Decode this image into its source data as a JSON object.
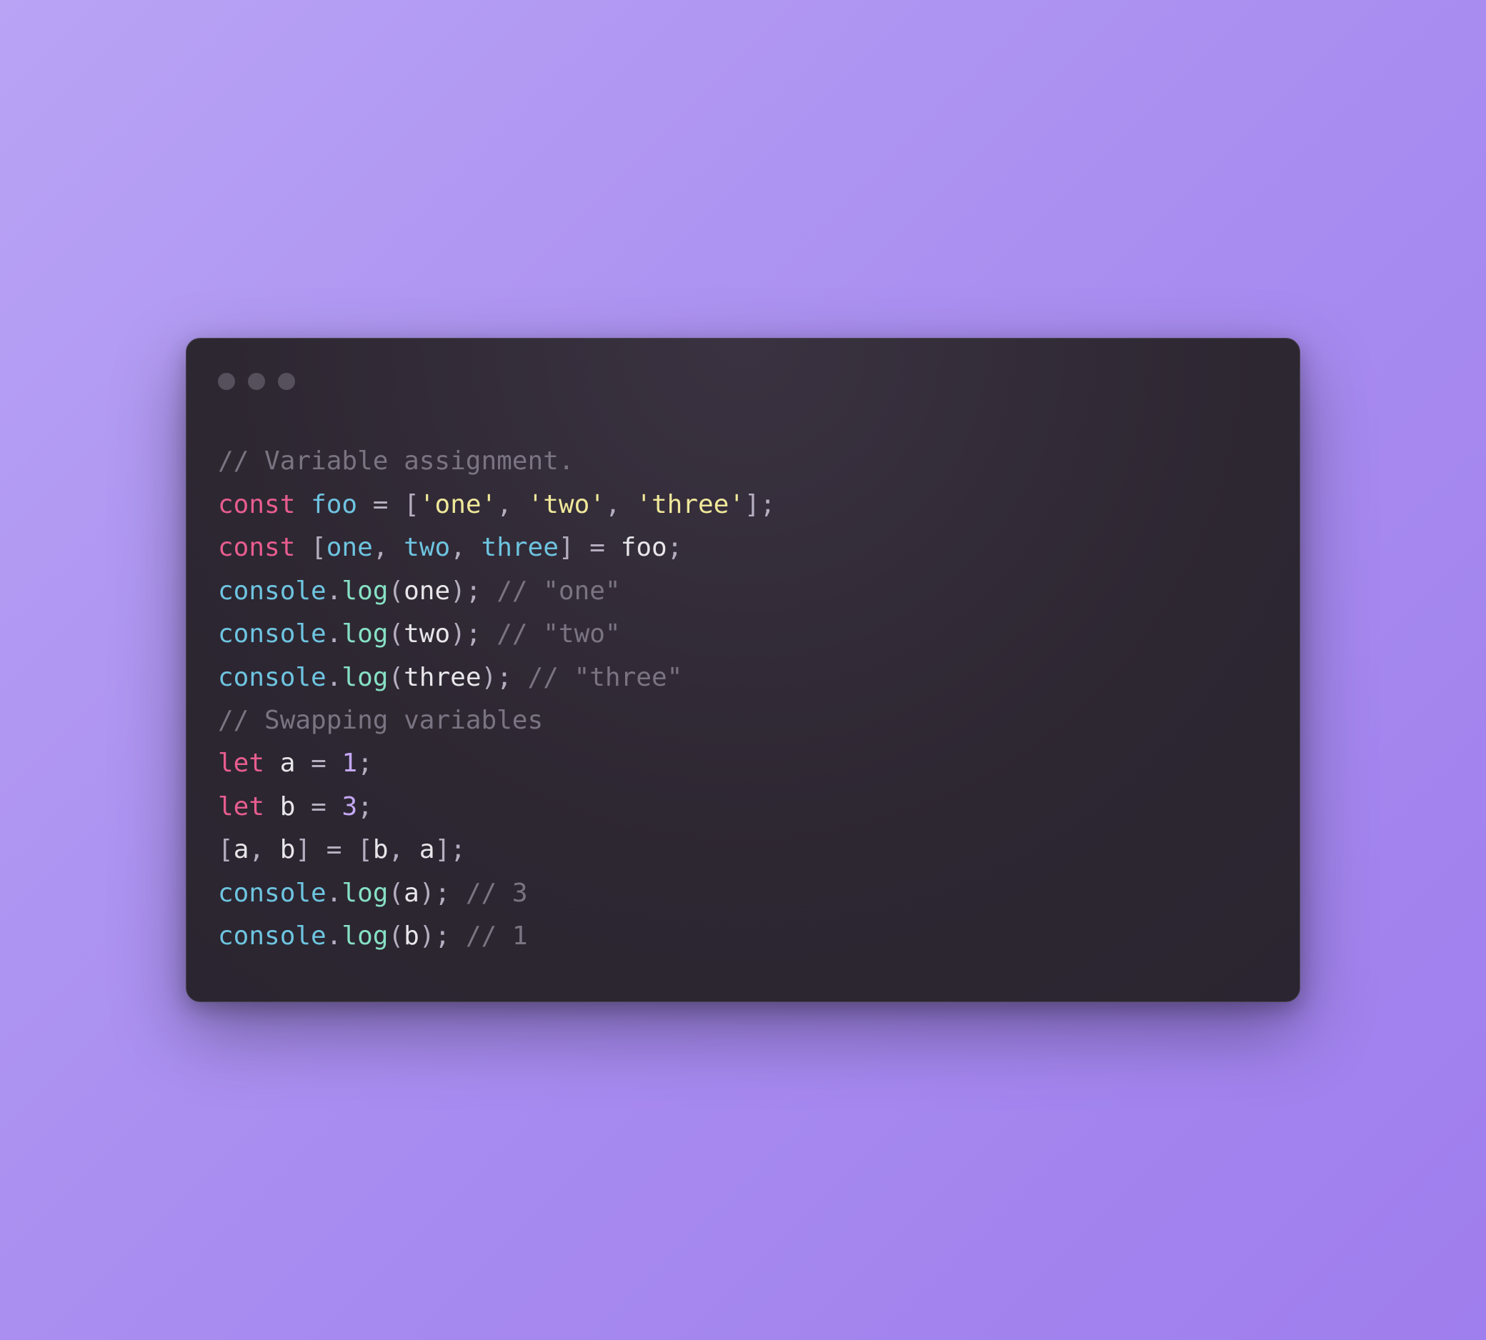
{
  "code": {
    "lines": [
      [
        {
          "cls": "tok-comment",
          "text": "// Variable assignment."
        }
      ],
      [
        {
          "cls": "tok-keyword",
          "text": "const"
        },
        {
          "cls": "tok-plain",
          "text": " "
        },
        {
          "cls": "tok-var",
          "text": "foo"
        },
        {
          "cls": "tok-plain",
          "text": " "
        },
        {
          "cls": "tok-punct",
          "text": "="
        },
        {
          "cls": "tok-plain",
          "text": " "
        },
        {
          "cls": "tok-punct",
          "text": "["
        },
        {
          "cls": "tok-string",
          "text": "'one'"
        },
        {
          "cls": "tok-punct",
          "text": ", "
        },
        {
          "cls": "tok-string",
          "text": "'two'"
        },
        {
          "cls": "tok-punct",
          "text": ", "
        },
        {
          "cls": "tok-string",
          "text": "'three'"
        },
        {
          "cls": "tok-punct",
          "text": "];"
        }
      ],
      [
        {
          "cls": "tok-keyword",
          "text": "const"
        },
        {
          "cls": "tok-plain",
          "text": " "
        },
        {
          "cls": "tok-punct",
          "text": "["
        },
        {
          "cls": "tok-var",
          "text": "one"
        },
        {
          "cls": "tok-punct",
          "text": ", "
        },
        {
          "cls": "tok-var",
          "text": "two"
        },
        {
          "cls": "tok-punct",
          "text": ", "
        },
        {
          "cls": "tok-var",
          "text": "three"
        },
        {
          "cls": "tok-punct",
          "text": "]"
        },
        {
          "cls": "tok-plain",
          "text": " "
        },
        {
          "cls": "tok-punct",
          "text": "="
        },
        {
          "cls": "tok-plain",
          "text": " foo"
        },
        {
          "cls": "tok-punct",
          "text": ";"
        }
      ],
      [
        {
          "cls": "tok-var",
          "text": "console"
        },
        {
          "cls": "tok-punct",
          "text": "."
        },
        {
          "cls": "tok-func",
          "text": "log"
        },
        {
          "cls": "tok-punct",
          "text": "("
        },
        {
          "cls": "tok-plain",
          "text": "one"
        },
        {
          "cls": "tok-punct",
          "text": ");"
        },
        {
          "cls": "tok-plain",
          "text": " "
        },
        {
          "cls": "tok-comment",
          "text": "// \"one\""
        }
      ],
      [
        {
          "cls": "tok-var",
          "text": "console"
        },
        {
          "cls": "tok-punct",
          "text": "."
        },
        {
          "cls": "tok-func",
          "text": "log"
        },
        {
          "cls": "tok-punct",
          "text": "("
        },
        {
          "cls": "tok-plain",
          "text": "two"
        },
        {
          "cls": "tok-punct",
          "text": ");"
        },
        {
          "cls": "tok-plain",
          "text": " "
        },
        {
          "cls": "tok-comment",
          "text": "// \"two\""
        }
      ],
      [
        {
          "cls": "tok-var",
          "text": "console"
        },
        {
          "cls": "tok-punct",
          "text": "."
        },
        {
          "cls": "tok-func",
          "text": "log"
        },
        {
          "cls": "tok-punct",
          "text": "("
        },
        {
          "cls": "tok-plain",
          "text": "three"
        },
        {
          "cls": "tok-punct",
          "text": ");"
        },
        {
          "cls": "tok-plain",
          "text": " "
        },
        {
          "cls": "tok-comment",
          "text": "// \"three\""
        }
      ],
      [
        {
          "cls": "tok-comment",
          "text": "// Swapping variables"
        }
      ],
      [
        {
          "cls": "tok-keyword",
          "text": "let"
        },
        {
          "cls": "tok-plain",
          "text": " a "
        },
        {
          "cls": "tok-punct",
          "text": "="
        },
        {
          "cls": "tok-plain",
          "text": " "
        },
        {
          "cls": "tok-number",
          "text": "1"
        },
        {
          "cls": "tok-punct",
          "text": ";"
        }
      ],
      [
        {
          "cls": "tok-keyword",
          "text": "let"
        },
        {
          "cls": "tok-plain",
          "text": " b "
        },
        {
          "cls": "tok-punct",
          "text": "="
        },
        {
          "cls": "tok-plain",
          "text": " "
        },
        {
          "cls": "tok-number",
          "text": "3"
        },
        {
          "cls": "tok-punct",
          "text": ";"
        }
      ],
      [
        {
          "cls": "tok-punct",
          "text": "["
        },
        {
          "cls": "tok-plain",
          "text": "a"
        },
        {
          "cls": "tok-punct",
          "text": ", "
        },
        {
          "cls": "tok-plain",
          "text": "b"
        },
        {
          "cls": "tok-punct",
          "text": "]"
        },
        {
          "cls": "tok-plain",
          "text": " "
        },
        {
          "cls": "tok-punct",
          "text": "="
        },
        {
          "cls": "tok-plain",
          "text": " "
        },
        {
          "cls": "tok-punct",
          "text": "["
        },
        {
          "cls": "tok-plain",
          "text": "b"
        },
        {
          "cls": "tok-punct",
          "text": ", "
        },
        {
          "cls": "tok-plain",
          "text": "a"
        },
        {
          "cls": "tok-punct",
          "text": "];"
        }
      ],
      [
        {
          "cls": "tok-var",
          "text": "console"
        },
        {
          "cls": "tok-punct",
          "text": "."
        },
        {
          "cls": "tok-func",
          "text": "log"
        },
        {
          "cls": "tok-punct",
          "text": "("
        },
        {
          "cls": "tok-plain",
          "text": "a"
        },
        {
          "cls": "tok-punct",
          "text": ");"
        },
        {
          "cls": "tok-plain",
          "text": " "
        },
        {
          "cls": "tok-comment",
          "text": "// 3"
        }
      ],
      [
        {
          "cls": "tok-var",
          "text": "console"
        },
        {
          "cls": "tok-punct",
          "text": "."
        },
        {
          "cls": "tok-func",
          "text": "log"
        },
        {
          "cls": "tok-punct",
          "text": "("
        },
        {
          "cls": "tok-plain",
          "text": "b"
        },
        {
          "cls": "tok-punct",
          "text": ");"
        },
        {
          "cls": "tok-plain",
          "text": " "
        },
        {
          "cls": "tok-comment",
          "text": "// 1"
        }
      ]
    ]
  }
}
